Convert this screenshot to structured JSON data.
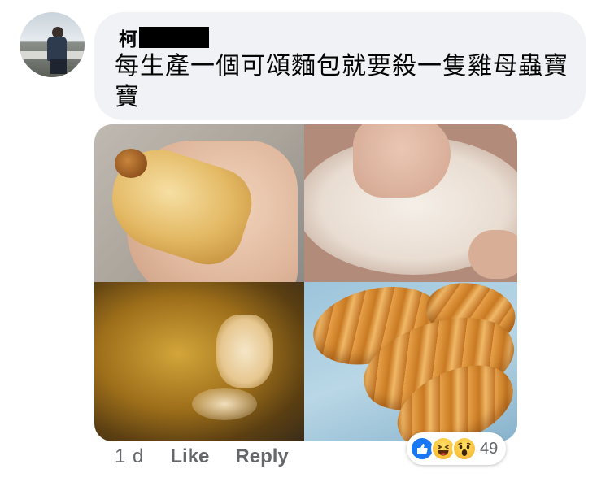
{
  "comment": {
    "author_visible": "柯",
    "text": "每生產一個可頌麵包就要殺一隻雞母蟲寶寶"
  },
  "actions": {
    "timestamp": "1 d",
    "like_label": "Like",
    "reply_label": "Reply"
  },
  "reactions": {
    "icons": [
      "like-icon",
      "haha-icon",
      "wow-icon"
    ],
    "count": "49"
  },
  "photos": [
    {
      "depicts": "grub-in-hand"
    },
    {
      "depicts": "flour-bowl"
    },
    {
      "depicts": "oil-pan"
    },
    {
      "depicts": "croissants"
    }
  ],
  "colors": {
    "bubble_bg": "#f0f2f5",
    "meta_text": "#65676b",
    "like_blue": "#1877f2",
    "reaction_yellow": "#f7b125"
  }
}
